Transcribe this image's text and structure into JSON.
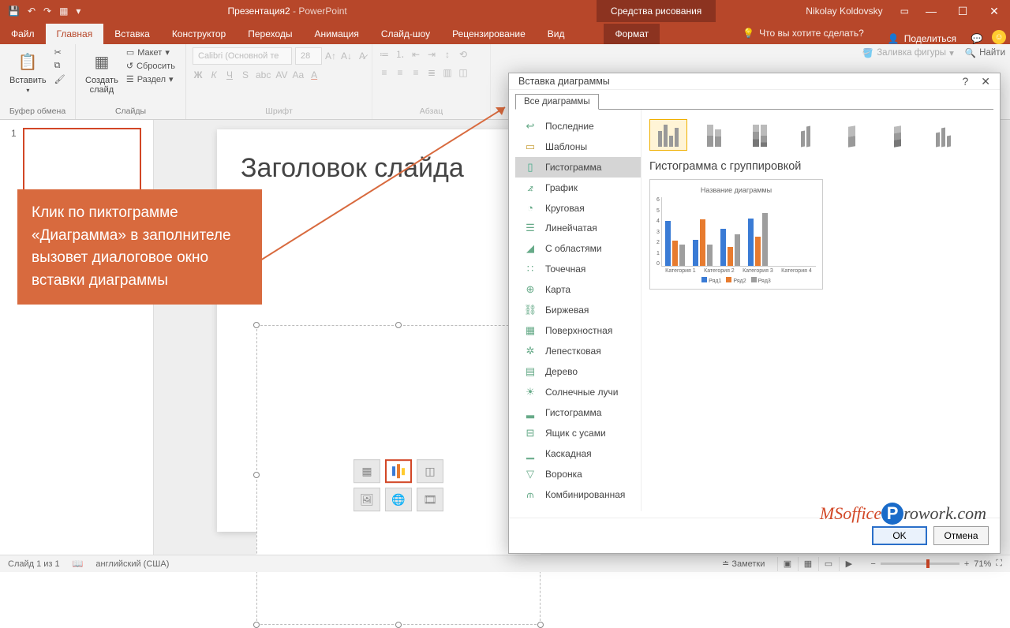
{
  "title": {
    "doc": "Презентация2",
    "app": " -  PowerPoint",
    "tools": "Средства рисования",
    "user": "Nikolay Koldovsky"
  },
  "qat": [
    "💾",
    "↶",
    "↷",
    "▦",
    "▾"
  ],
  "tabs": [
    "Файл",
    "Главная",
    "Вставка",
    "Конструктор",
    "Переходы",
    "Анимация",
    "Слайд-шоу",
    "Рецензирование",
    "Вид",
    "Формат"
  ],
  "help": "Что вы хотите сделать?",
  "share": "Поделиться",
  "ribbon": {
    "paste": "Вставить",
    "clipboard": "Буфер обмена",
    "newslide": "Создать\nслайд",
    "layout": "Макет",
    "reset": "Сбросить",
    "section": "Раздел",
    "slides": "Слайды",
    "font": "Calibri (Основной те",
    "size": "28",
    "fontgrp": "Шрифт",
    "para": "Абзац",
    "fill": "Заливка фигуры",
    "find": "Найти"
  },
  "thumb": {
    "num": "1"
  },
  "slide": {
    "title": "Заголовок слайда"
  },
  "callout": "Клик по пиктограмме «Диаграмма» в заполнителе вызовет диалоговое окно вставки диаграммы",
  "dialog": {
    "title": "Вставка диаграммы",
    "tab": "Все диаграммы",
    "cats": [
      "Последние",
      "Шаблоны",
      "Гистограмма",
      "График",
      "Круговая",
      "Линейчатая",
      "С областями",
      "Точечная",
      "Карта",
      "Биржевая",
      "Поверхностная",
      "Лепестковая",
      "Дерево",
      "Солнечные лучи",
      "Гистограмма",
      "Ящик с усами",
      "Каскадная",
      "Воронка",
      "Комбинированная"
    ],
    "cat_icons": [
      "↩",
      "▭",
      "▯",
      "⦨",
      "◔",
      "☰",
      "◢",
      "∷",
      "⊕",
      "⛓",
      "▦",
      "✲",
      "▤",
      "☀",
      "▂",
      "⊟",
      "▁",
      "▽",
      "⫙"
    ],
    "selected_cat": 2,
    "preview_title": "Гистограмма с группировкой",
    "ok": "OK",
    "cancel": "Отмена"
  },
  "chart_data": {
    "type": "bar",
    "title": "Название диаграммы",
    "categories": [
      "Категория 1",
      "Категория 2",
      "Категория 3",
      "Категория 4"
    ],
    "series": [
      {
        "name": "Ряд1",
        "color": "#3a7bd5",
        "values": [
          4.3,
          2.5,
          3.5,
          4.5
        ]
      },
      {
        "name": "Ряд2",
        "color": "#e77b2f",
        "values": [
          2.4,
          4.4,
          1.8,
          2.8
        ]
      },
      {
        "name": "Ряд3",
        "color": "#9e9e9e",
        "values": [
          2.0,
          2.0,
          3.0,
          5.0
        ]
      }
    ],
    "ylim": [
      0,
      6
    ],
    "yticks": [
      0,
      1,
      2,
      3,
      4,
      5,
      6
    ]
  },
  "status": {
    "slide": "Слайд 1 из 1",
    "lang": "английский (США)",
    "notes": "Заметки",
    "zoom": "71%"
  },
  "watermark": {
    "a": "MSoffice",
    "b": "P",
    "c": "rowork.com"
  }
}
